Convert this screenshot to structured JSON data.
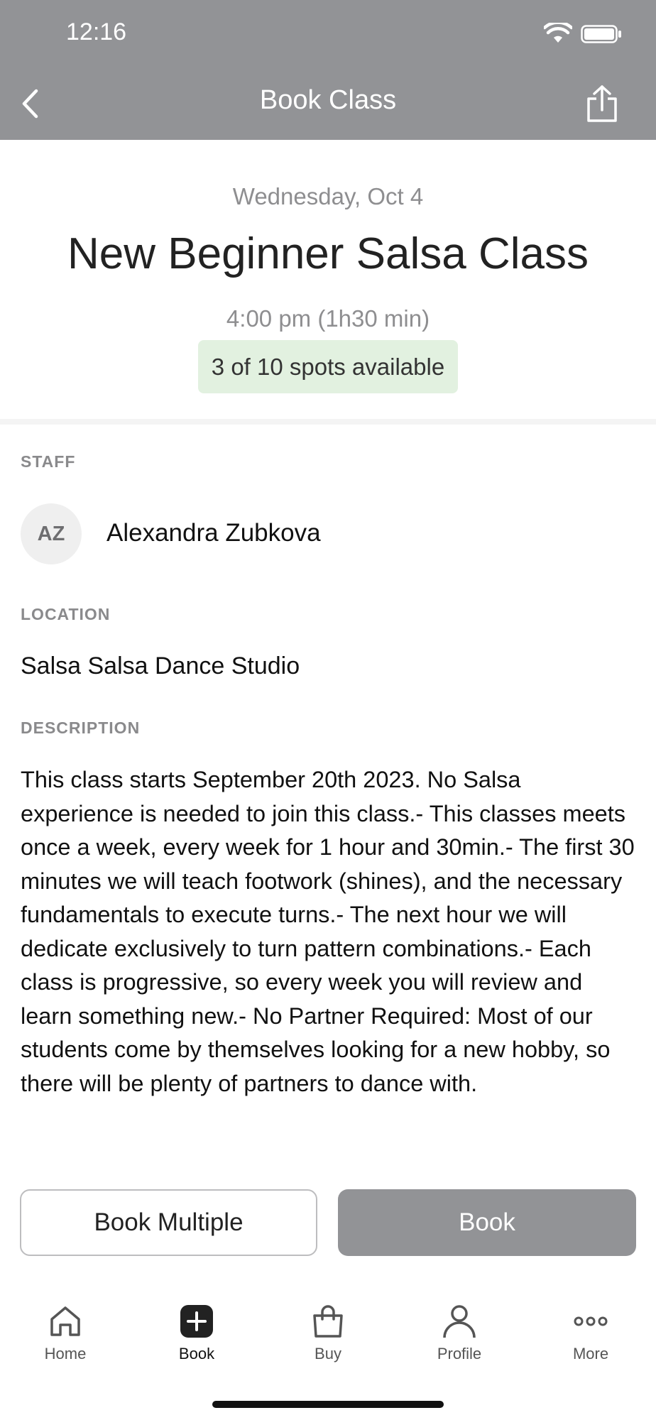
{
  "status_bar": {
    "time": "12:16",
    "wifi_icon": "wifi-icon",
    "battery_icon": "battery-icon"
  },
  "header": {
    "title": "Book Class",
    "back_icon": "chevron-left-icon",
    "share_icon": "share-icon",
    "background": "#929396"
  },
  "class": {
    "date": "Wednesday, Oct 4",
    "title": "New Beginner Salsa Class",
    "time": "4:00 pm (1h30 min)",
    "spots": "3 of 10 spots available",
    "spots_badge_color": "#e2f1e0"
  },
  "staff": {
    "label": "STAFF",
    "initials": "AZ",
    "name": "Alexandra Zubkova"
  },
  "location": {
    "label": "LOCATION",
    "name": "Salsa Salsa Dance Studio"
  },
  "description": {
    "label": "DESCRIPTION",
    "text": "This class starts September 20th 2023. No Salsa experience is needed to join this class.- This classes meets once a week, every week for 1 hour and 30min.- The first 30 minutes we will teach footwork (shines), and the necessary fundamentals to execute turns.- The next hour we will dedicate exclusively to turn pattern combinations.- Each class is progressive, so every week you will review and learn something new.- No Partner Required: Most of our students come by themselves looking for a new hobby, so there will be plenty of partners to dance with."
  },
  "actions": {
    "book_multiple": "Book Multiple",
    "book": "Book",
    "book_color": "#929396"
  },
  "tabbar": {
    "items": [
      {
        "label": "Home",
        "icon": "home-icon"
      },
      {
        "label": "Book",
        "icon": "plus-square-icon",
        "active": true
      },
      {
        "label": "Buy",
        "icon": "shopping-bag-icon"
      },
      {
        "label": "Profile",
        "icon": "person-icon"
      },
      {
        "label": "More",
        "icon": "more-dots-icon"
      }
    ]
  }
}
